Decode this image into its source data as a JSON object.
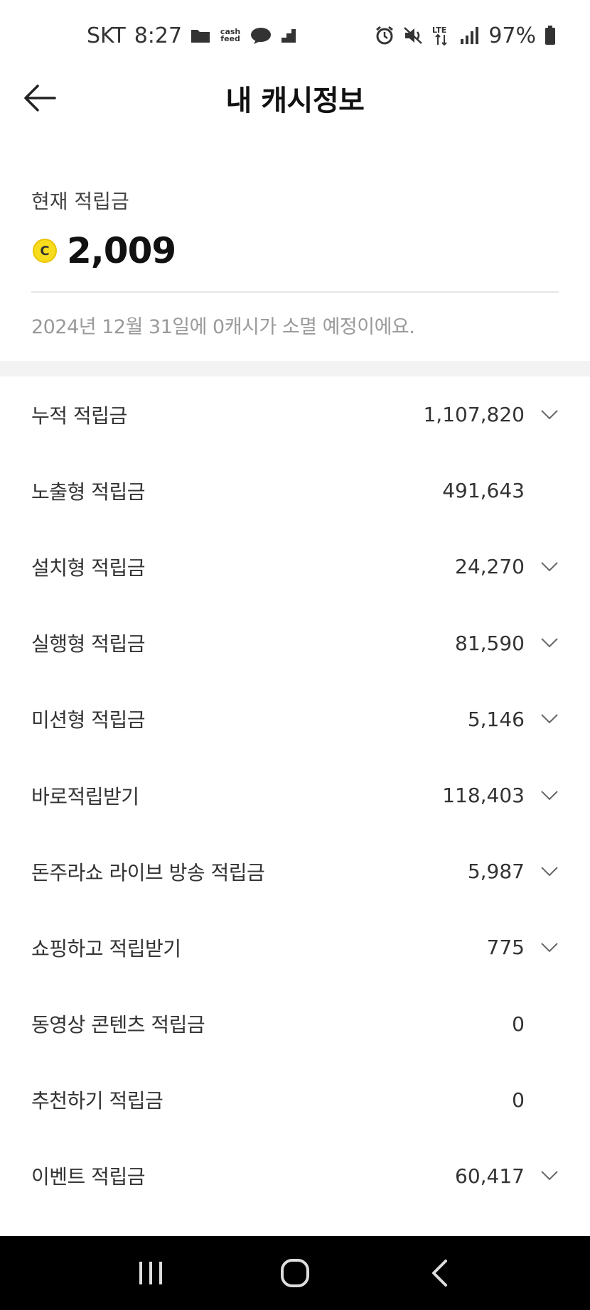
{
  "status_bar": {
    "carrier": "SKT",
    "time": "8:27",
    "battery": "97%",
    "network": "LTE",
    "left_icons": [
      "folder-icon",
      "cashfeed-icon",
      "chat-bubble-icon",
      "stairs-icon"
    ],
    "right_icons": [
      "alarm-icon",
      "mute-icon",
      "lte-icon",
      "signal-icon",
      "battery-icon"
    ],
    "cashfeed_text": "cash feed"
  },
  "header": {
    "title": "내 캐시정보",
    "back_icon": "arrow-left-icon"
  },
  "balance": {
    "label": "현재 적립금",
    "coin_symbol": "C",
    "amount": "2,009",
    "expire_notice": "2024년 12월 31일에 0캐시가 소멸 예정이에요."
  },
  "items": [
    {
      "label": "누적 적립금",
      "value": "1,107,820",
      "expandable": true
    },
    {
      "label": "노출형 적립금",
      "value": "491,643",
      "expandable": false
    },
    {
      "label": "설치형 적립금",
      "value": "24,270",
      "expandable": true
    },
    {
      "label": "실행형 적립금",
      "value": "81,590",
      "expandable": true
    },
    {
      "label": "미션형 적립금",
      "value": "5,146",
      "expandable": true
    },
    {
      "label": "바로적립받기",
      "value": "118,403",
      "expandable": true
    },
    {
      "label": "돈주라쇼 라이브 방송 적립금",
      "value": "5,987",
      "expandable": true
    },
    {
      "label": "쇼핑하고 적립받기",
      "value": "775",
      "expandable": true
    },
    {
      "label": "동영상 콘텐츠 적립금",
      "value": "0",
      "expandable": false
    },
    {
      "label": "추천하기 적립금",
      "value": "0",
      "expandable": false
    },
    {
      "label": "이벤트 적립금",
      "value": "60,417",
      "expandable": true
    }
  ],
  "colors": {
    "coin": "#f7dc1e",
    "text": "#333333",
    "muted": "#9a9a9a",
    "divider": "#e6e6e6",
    "nav_bar": "#000000"
  },
  "nav": [
    "recent-apps-icon",
    "home-icon",
    "back-icon"
  ]
}
